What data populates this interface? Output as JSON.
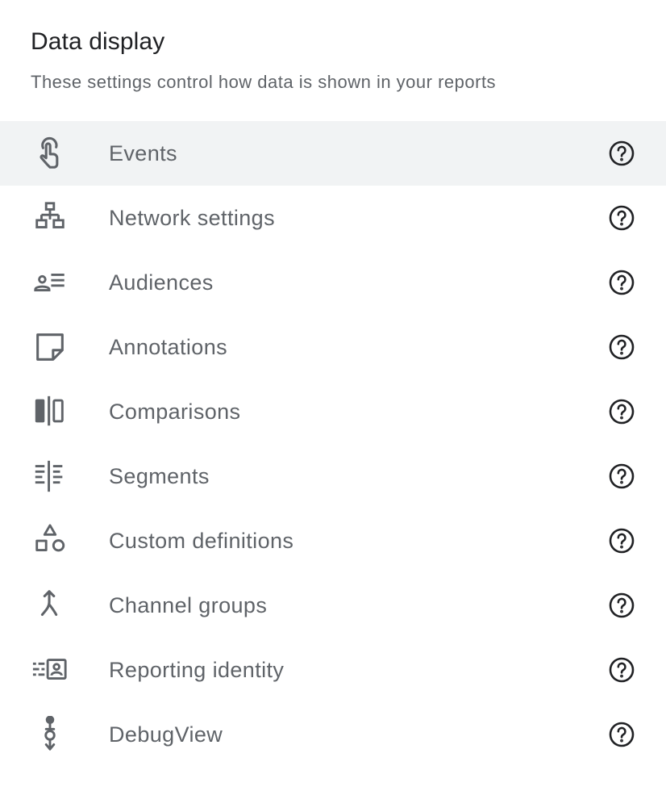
{
  "header": {
    "title": "Data display",
    "subtitle": "These settings control how data is shown in your reports"
  },
  "colors": {
    "text_primary": "#202124",
    "text_secondary": "#5f6368",
    "icon": "#5f6368",
    "help_icon": "#202124",
    "active_row_bg": "#f1f3f4"
  },
  "items": [
    {
      "label": "Events",
      "icon": "touch-app-icon",
      "active": true
    },
    {
      "label": "Network settings",
      "icon": "network-icon",
      "active": false
    },
    {
      "label": "Audiences",
      "icon": "audience-list-icon",
      "active": false
    },
    {
      "label": "Annotations",
      "icon": "sticky-note-icon",
      "active": false
    },
    {
      "label": "Comparisons",
      "icon": "compare-columns-icon",
      "active": false
    },
    {
      "label": "Segments",
      "icon": "segment-split-icon",
      "active": false
    },
    {
      "label": "Custom definitions",
      "icon": "shapes-icon",
      "active": false
    },
    {
      "label": "Channel groups",
      "icon": "merge-arrow-icon",
      "active": false
    },
    {
      "label": "Reporting identity",
      "icon": "identity-badge-icon",
      "active": false
    },
    {
      "label": "DebugView",
      "icon": "debug-flow-icon",
      "active": false
    }
  ],
  "help_icon": "help-circle-icon"
}
